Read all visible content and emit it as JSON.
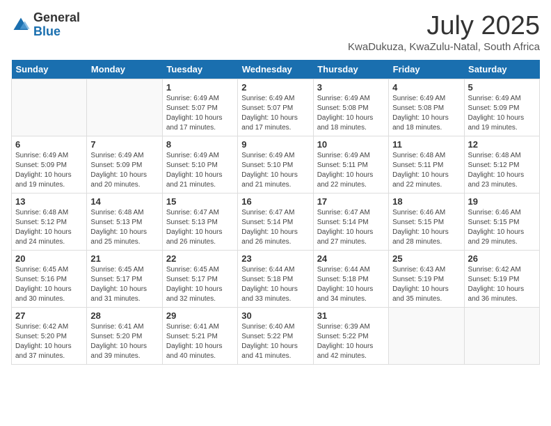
{
  "header": {
    "logo_general": "General",
    "logo_blue": "Blue",
    "month_year": "July 2025",
    "location": "KwaDukuza, KwaZulu-Natal, South Africa"
  },
  "days_of_week": [
    "Sunday",
    "Monday",
    "Tuesday",
    "Wednesday",
    "Thursday",
    "Friday",
    "Saturday"
  ],
  "weeks": [
    [
      {
        "day": "",
        "info": ""
      },
      {
        "day": "",
        "info": ""
      },
      {
        "day": "1",
        "info": "Sunrise: 6:49 AM\nSunset: 5:07 PM\nDaylight: 10 hours and 17 minutes."
      },
      {
        "day": "2",
        "info": "Sunrise: 6:49 AM\nSunset: 5:07 PM\nDaylight: 10 hours and 17 minutes."
      },
      {
        "day": "3",
        "info": "Sunrise: 6:49 AM\nSunset: 5:08 PM\nDaylight: 10 hours and 18 minutes."
      },
      {
        "day": "4",
        "info": "Sunrise: 6:49 AM\nSunset: 5:08 PM\nDaylight: 10 hours and 18 minutes."
      },
      {
        "day": "5",
        "info": "Sunrise: 6:49 AM\nSunset: 5:09 PM\nDaylight: 10 hours and 19 minutes."
      }
    ],
    [
      {
        "day": "6",
        "info": "Sunrise: 6:49 AM\nSunset: 5:09 PM\nDaylight: 10 hours and 19 minutes."
      },
      {
        "day": "7",
        "info": "Sunrise: 6:49 AM\nSunset: 5:09 PM\nDaylight: 10 hours and 20 minutes."
      },
      {
        "day": "8",
        "info": "Sunrise: 6:49 AM\nSunset: 5:10 PM\nDaylight: 10 hours and 21 minutes."
      },
      {
        "day": "9",
        "info": "Sunrise: 6:49 AM\nSunset: 5:10 PM\nDaylight: 10 hours and 21 minutes."
      },
      {
        "day": "10",
        "info": "Sunrise: 6:49 AM\nSunset: 5:11 PM\nDaylight: 10 hours and 22 minutes."
      },
      {
        "day": "11",
        "info": "Sunrise: 6:48 AM\nSunset: 5:11 PM\nDaylight: 10 hours and 22 minutes."
      },
      {
        "day": "12",
        "info": "Sunrise: 6:48 AM\nSunset: 5:12 PM\nDaylight: 10 hours and 23 minutes."
      }
    ],
    [
      {
        "day": "13",
        "info": "Sunrise: 6:48 AM\nSunset: 5:12 PM\nDaylight: 10 hours and 24 minutes."
      },
      {
        "day": "14",
        "info": "Sunrise: 6:48 AM\nSunset: 5:13 PM\nDaylight: 10 hours and 25 minutes."
      },
      {
        "day": "15",
        "info": "Sunrise: 6:47 AM\nSunset: 5:13 PM\nDaylight: 10 hours and 26 minutes."
      },
      {
        "day": "16",
        "info": "Sunrise: 6:47 AM\nSunset: 5:14 PM\nDaylight: 10 hours and 26 minutes."
      },
      {
        "day": "17",
        "info": "Sunrise: 6:47 AM\nSunset: 5:14 PM\nDaylight: 10 hours and 27 minutes."
      },
      {
        "day": "18",
        "info": "Sunrise: 6:46 AM\nSunset: 5:15 PM\nDaylight: 10 hours and 28 minutes."
      },
      {
        "day": "19",
        "info": "Sunrise: 6:46 AM\nSunset: 5:15 PM\nDaylight: 10 hours and 29 minutes."
      }
    ],
    [
      {
        "day": "20",
        "info": "Sunrise: 6:45 AM\nSunset: 5:16 PM\nDaylight: 10 hours and 30 minutes."
      },
      {
        "day": "21",
        "info": "Sunrise: 6:45 AM\nSunset: 5:17 PM\nDaylight: 10 hours and 31 minutes."
      },
      {
        "day": "22",
        "info": "Sunrise: 6:45 AM\nSunset: 5:17 PM\nDaylight: 10 hours and 32 minutes."
      },
      {
        "day": "23",
        "info": "Sunrise: 6:44 AM\nSunset: 5:18 PM\nDaylight: 10 hours and 33 minutes."
      },
      {
        "day": "24",
        "info": "Sunrise: 6:44 AM\nSunset: 5:18 PM\nDaylight: 10 hours and 34 minutes."
      },
      {
        "day": "25",
        "info": "Sunrise: 6:43 AM\nSunset: 5:19 PM\nDaylight: 10 hours and 35 minutes."
      },
      {
        "day": "26",
        "info": "Sunrise: 6:42 AM\nSunset: 5:19 PM\nDaylight: 10 hours and 36 minutes."
      }
    ],
    [
      {
        "day": "27",
        "info": "Sunrise: 6:42 AM\nSunset: 5:20 PM\nDaylight: 10 hours and 37 minutes."
      },
      {
        "day": "28",
        "info": "Sunrise: 6:41 AM\nSunset: 5:20 PM\nDaylight: 10 hours and 39 minutes."
      },
      {
        "day": "29",
        "info": "Sunrise: 6:41 AM\nSunset: 5:21 PM\nDaylight: 10 hours and 40 minutes."
      },
      {
        "day": "30",
        "info": "Sunrise: 6:40 AM\nSunset: 5:22 PM\nDaylight: 10 hours and 41 minutes."
      },
      {
        "day": "31",
        "info": "Sunrise: 6:39 AM\nSunset: 5:22 PM\nDaylight: 10 hours and 42 minutes."
      },
      {
        "day": "",
        "info": ""
      },
      {
        "day": "",
        "info": ""
      }
    ]
  ]
}
